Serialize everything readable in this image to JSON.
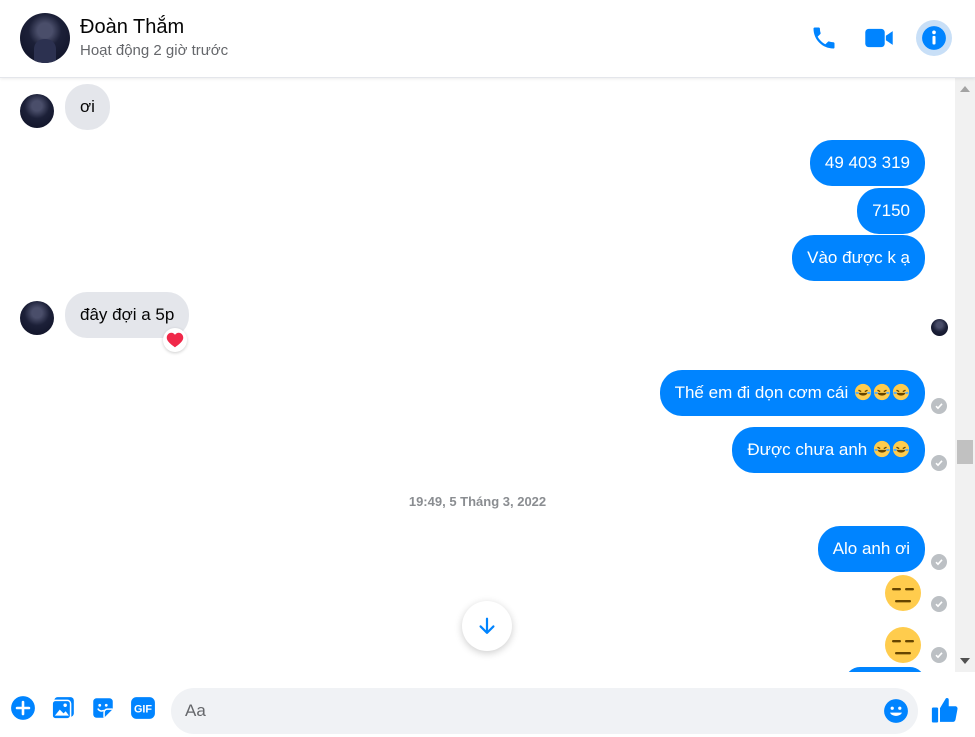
{
  "header": {
    "contact_name": "Đoàn Thắm",
    "status": "Hoạt động 2 giờ trước",
    "icons": [
      "phone-icon",
      "video-camera-icon",
      "info-icon"
    ]
  },
  "messages": [
    {
      "side": "in",
      "text": "ơi"
    },
    {
      "side": "out",
      "text": "49 403 319"
    },
    {
      "side": "out",
      "text": "7150"
    },
    {
      "side": "out",
      "text": "Vào được k ạ"
    },
    {
      "side": "in",
      "text": "đây đợi a 5p",
      "reaction": "heart"
    },
    {
      "side": "out",
      "text": "Thế em đi dọn cơm cái",
      "emoji": [
        "rolling-laugh",
        "rolling-laugh",
        "rolling-laugh"
      ]
    },
    {
      "side": "out",
      "text": "Được chưa anh",
      "emoji": [
        "rolling-laugh",
        "rolling-laugh"
      ]
    },
    {
      "side": "out",
      "text": "Alo anh ơi"
    },
    {
      "side": "out",
      "big_emoji": "expressionless-face"
    },
    {
      "side": "out",
      "big_emoji": "expressionless-face"
    }
  ],
  "timestamp": "19:49, 5 Tháng 3, 2022",
  "composer": {
    "placeholder": "Aa",
    "icons": [
      "plus-icon",
      "photo-icon",
      "sticker-icon",
      "gif-icon",
      "emoji-icon",
      "like-icon"
    ]
  },
  "colors": {
    "accent": "#0084ff",
    "incoming_bubble": "#e4e6eb",
    "text_secondary": "#65676b"
  }
}
